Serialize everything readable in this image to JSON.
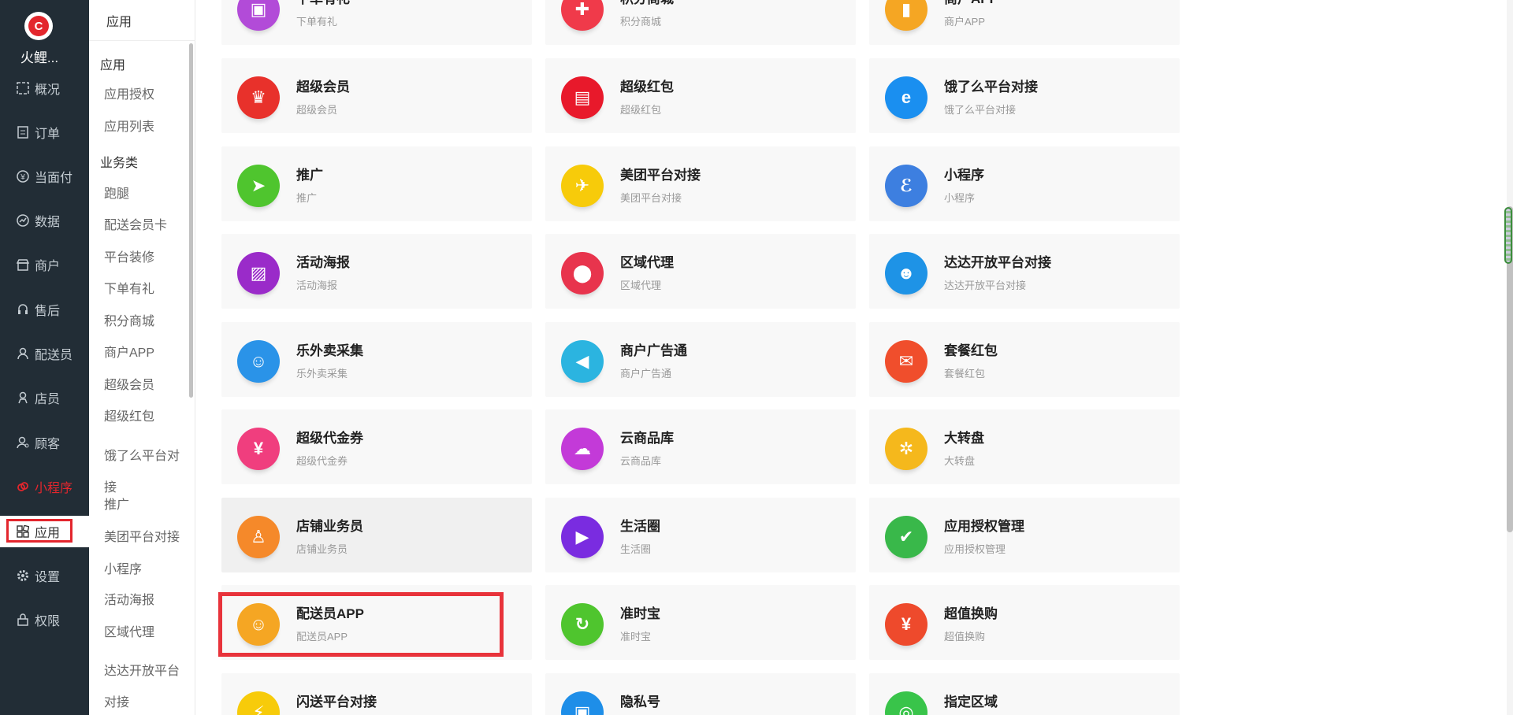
{
  "nav": {
    "brand": "火鲤...",
    "items": [
      {
        "label": "概况",
        "icon": "dashboard-icon"
      },
      {
        "label": "订单",
        "icon": "order-list-icon"
      },
      {
        "label": "当面付",
        "icon": "yen-circle-icon"
      },
      {
        "label": "数据",
        "icon": "chart-circle-icon"
      },
      {
        "label": "商户",
        "icon": "store-icon"
      },
      {
        "label": "售后",
        "icon": "headset-icon"
      },
      {
        "label": "配送员",
        "icon": "courier-icon"
      },
      {
        "label": "店员",
        "icon": "clerk-icon"
      },
      {
        "label": "顾客",
        "icon": "customer-icon"
      },
      {
        "label": "小程序",
        "icon": "miniprogram-icon"
      },
      {
        "label": "应用",
        "icon": "apps-grid-icon"
      },
      {
        "label": "设置",
        "icon": "gear-icon"
      },
      {
        "label": "权限",
        "icon": "lock-icon"
      }
    ]
  },
  "sub": {
    "header": "应用",
    "group1": "应用",
    "auth": "应用授权",
    "list": "应用列表",
    "group2": "业务类",
    "items": [
      "跑腿",
      "配送会员卡",
      "平台装修",
      "下单有礼",
      "积分商城",
      "商户APP",
      "超级会员",
      "超级红包",
      "饿了么平台对接",
      "推广",
      "美团平台对接",
      "小程序",
      "活动海报",
      "区域代理",
      "达达开放平台对接"
    ]
  },
  "cards": [
    {
      "title": "下单有礼",
      "desc": "下单有礼",
      "icon": "gift-bag-icon",
      "color": "#b24bd8"
    },
    {
      "title": "积分商城",
      "desc": "积分商城",
      "icon": "gift-icon",
      "color": "#f03a4a"
    },
    {
      "title": "商户APP",
      "desc": "商户APP",
      "icon": "phone-icon",
      "color": "#f5a623"
    },
    {
      "title": "超级会员",
      "desc": "超级会员",
      "icon": "vip-badge-icon",
      "color": "#e8312b"
    },
    {
      "title": "超级红包",
      "desc": "超级红包",
      "icon": "wallet-icon",
      "color": "#e8192b"
    },
    {
      "title": "饿了么平台对接",
      "desc": "饿了么平台对接",
      "icon": "eleme-logo-icon",
      "color": "#1a8ff0"
    },
    {
      "title": "推广",
      "desc": "推广",
      "icon": "paper-plane-icon",
      "color": "#4fc52e"
    },
    {
      "title": "美团平台对接",
      "desc": "美团平台对接",
      "icon": "kangaroo-icon",
      "color": "#f7cb0a"
    },
    {
      "title": "小程序",
      "desc": "小程序",
      "icon": "miniprogram-logo-icon",
      "color": "#3d7fe0"
    },
    {
      "title": "活动海报",
      "desc": "活动海报",
      "icon": "poster-icon",
      "color": "#9a2bc9"
    },
    {
      "title": "区域代理",
      "desc": "区域代理",
      "icon": "location-pin-icon",
      "color": "#e8344d"
    },
    {
      "title": "达达开放平台对接",
      "desc": "达达开放平台对接",
      "icon": "runner-icon",
      "color": "#1e93e6"
    },
    {
      "title": "乐外卖采集",
      "desc": "乐外卖采集",
      "icon": "lewaimai-logo-icon",
      "color": "#2a93e8"
    },
    {
      "title": "商户广告通",
      "desc": "商户广告通",
      "icon": "speaker-icon",
      "color": "#2bb4e0"
    },
    {
      "title": "套餐红包",
      "desc": "套餐红包",
      "icon": "red-envelope-icon",
      "color": "#f04e2c"
    },
    {
      "title": "超级代金券",
      "desc": "超级代金券",
      "icon": "coupon-icon",
      "color": "#f03e7e"
    },
    {
      "title": "云商品库",
      "desc": "云商品库",
      "icon": "cloud-icon",
      "color": "#c33ad8"
    },
    {
      "title": "大转盘",
      "desc": "大转盘",
      "icon": "wheel-icon",
      "color": "#f5b81c"
    },
    {
      "title": "店铺业务员",
      "desc": "店铺业务员",
      "icon": "salesman-icon",
      "color": "#f5892a"
    },
    {
      "title": "生活圈",
      "desc": "生活圈",
      "icon": "play-circle-icon",
      "color": "#7a2ce0"
    },
    {
      "title": "应用授权管理",
      "desc": "应用授权管理",
      "icon": "shield-check-icon",
      "color": "#39b84a"
    },
    {
      "title": "配送员APP",
      "desc": "配送员APP",
      "icon": "courier-face-icon",
      "color": "#f5a623"
    },
    {
      "title": "准时宝",
      "desc": "准时宝",
      "icon": "clock-arrow-icon",
      "color": "#4fc52e"
    },
    {
      "title": "超值换购",
      "desc": "超值换购",
      "icon": "exchange-icon",
      "color": "#ee4a2c"
    },
    {
      "title": "闪送平台对接",
      "desc": "",
      "icon": "flash-icon",
      "color": "#f7cb0a"
    },
    {
      "title": "隐私号",
      "desc": "",
      "icon": "lock-icon",
      "color": "#1e8ee8"
    },
    {
      "title": "指定区域",
      "desc": "",
      "icon": "area-icon",
      "color": "#39c44a"
    }
  ]
}
